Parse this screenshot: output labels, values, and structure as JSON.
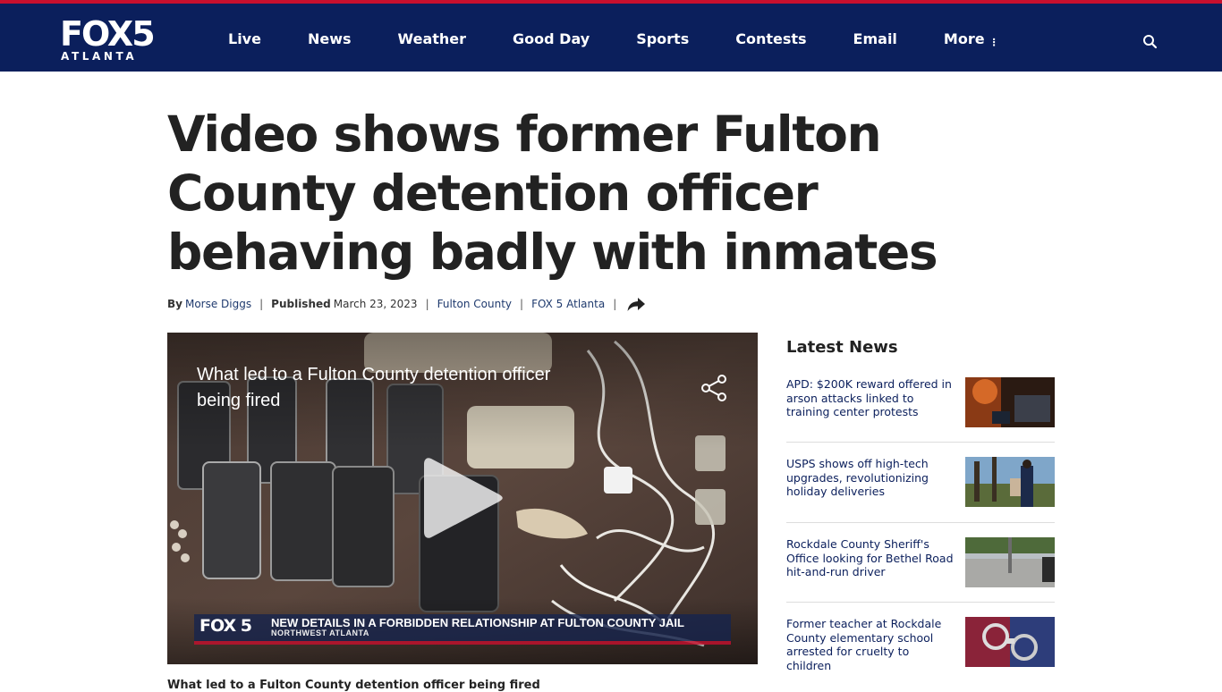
{
  "header": {
    "logo_main": "FOX5",
    "logo_sub": "ATLANTA",
    "nav": [
      "Live",
      "News",
      "Weather",
      "Good Day",
      "Sports",
      "Contests",
      "Email",
      "More"
    ],
    "colors": {
      "nav_bg": "#0b1f5c",
      "accent": "#c8102e"
    }
  },
  "article": {
    "headline": "Video shows former Fulton County detention officer behaving badly with inmates",
    "byline": {
      "by_label": "By",
      "author": "Morse Diggs",
      "published_label": "Published",
      "date": "March 23, 2023",
      "category": "Fulton County",
      "source": "FOX 5 Atlanta"
    },
    "video": {
      "title": "What led to a Fulton County detention officer being fired",
      "lower_third_logo": "FOX 5",
      "lower_third_text": "NEW DETAILS IN A FORBIDDEN RELATIONSHIP AT FULTON COUNTY JAIL",
      "lower_third_sub": "NORTHWEST ATLANTA"
    },
    "caption": "What led to a Fulton County detention officer being fired"
  },
  "sidebar": {
    "title": "Latest News",
    "items": [
      {
        "text": "APD: $200K reward offered in arson attacks linked to training center protests"
      },
      {
        "text": "USPS shows off high-tech upgrades, revolutionizing holiday deliveries"
      },
      {
        "text": "Rockdale County Sheriff's Office looking for Bethel Road hit-and-run driver"
      },
      {
        "text": "Former teacher at Rockdale County elementary school arrested for cruelty to children"
      }
    ]
  }
}
